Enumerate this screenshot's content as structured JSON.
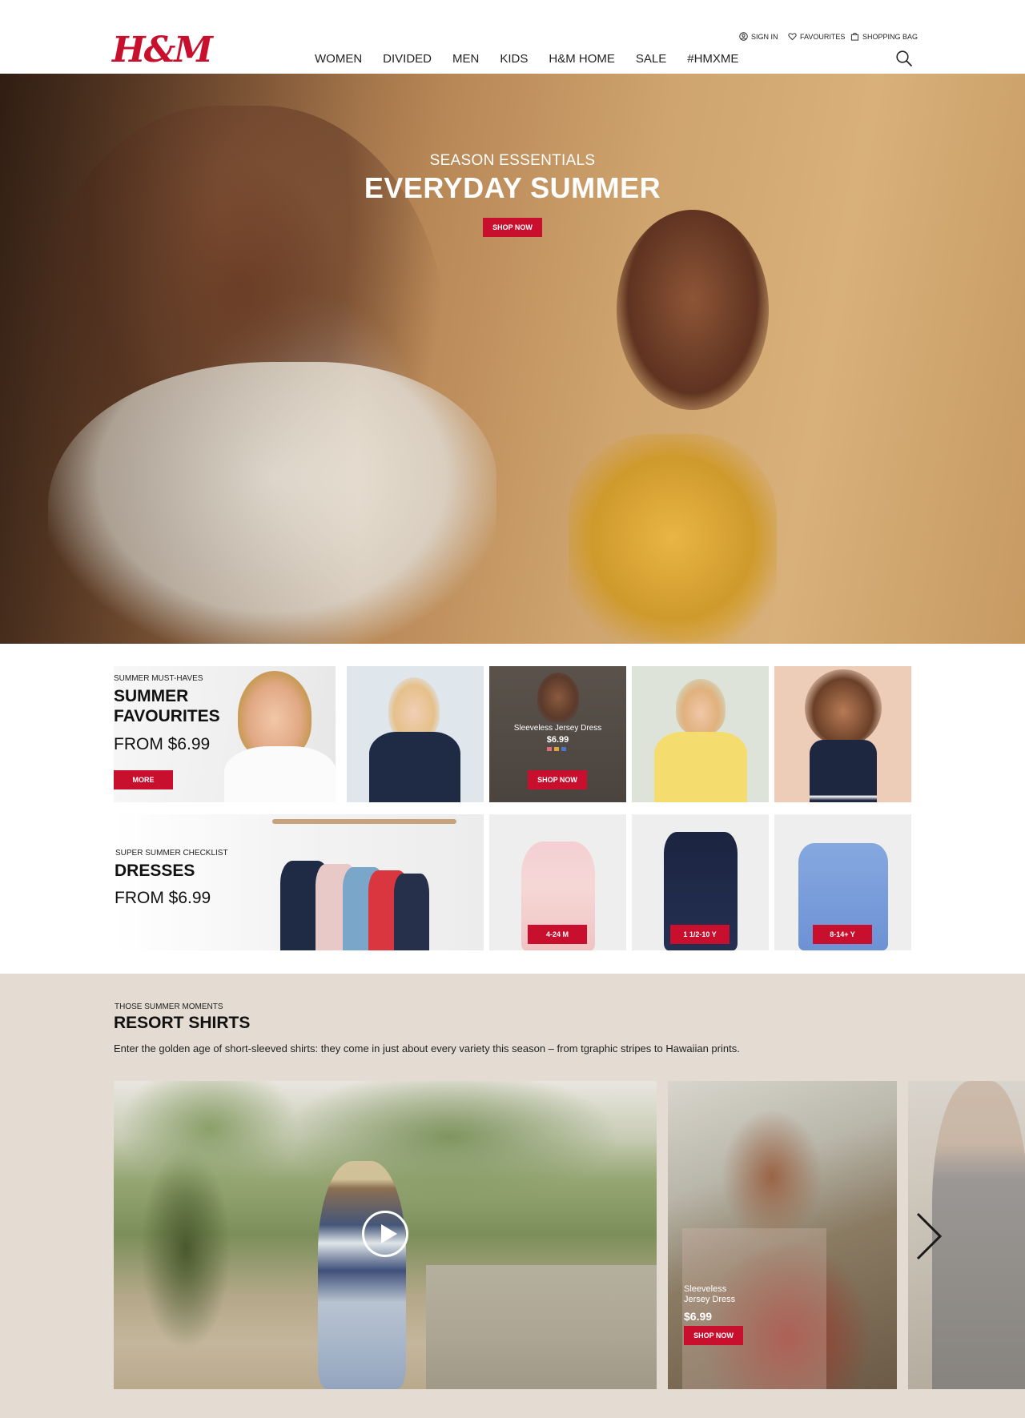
{
  "brand": {
    "logo": "H&M",
    "accent": "#c8102e"
  },
  "utility": {
    "sign_in": "SIGN IN",
    "favourites": "FAVOURITES",
    "shopping_bag": "SHOPPING BAG"
  },
  "nav": [
    "WOMEN",
    "DIVIDED",
    "MEN",
    "KIDS",
    "H&M HOME",
    "SALE",
    "#HMXME"
  ],
  "hero": {
    "eyebrow": "SEASON ESSENTIALS",
    "title": "EVERYDAY SUMMER",
    "cta": "SHOP NOW"
  },
  "summer_favourites": {
    "label": "SUMMER MUST-HAVES",
    "title_line1": "SUMMER",
    "title_line2": "FAVOURITES",
    "price": "FROM $6.99",
    "cta": "MORE"
  },
  "featured_product": {
    "name": "Sleeveless Jersey Dress",
    "price": "$6.99",
    "cta": "SHOP NOW"
  },
  "dresses": {
    "label": "SUPER SUMMER CHECKLIST",
    "title": "DRESSES",
    "price": "FROM $6.99",
    "sizes": [
      "4-24 M",
      "1 1/2-10 Y",
      "8-14+ Y"
    ]
  },
  "resort": {
    "eyebrow": "THOSE SUMMER MOMENTS",
    "title": "RESORT SHIRTS",
    "description": "Enter the golden age of short-sleeved shirts: they come in just about every variety this season – from tgraphic stripes to Hawaiian prints.",
    "card": {
      "name": "Sleeveless Jersey Dress",
      "price": "$6.99",
      "cta": "SHOP NOW"
    }
  },
  "icons": [
    "user-icon",
    "heart-icon",
    "bag-icon",
    "search-icon",
    "play-icon",
    "chevron-right-icon"
  ]
}
